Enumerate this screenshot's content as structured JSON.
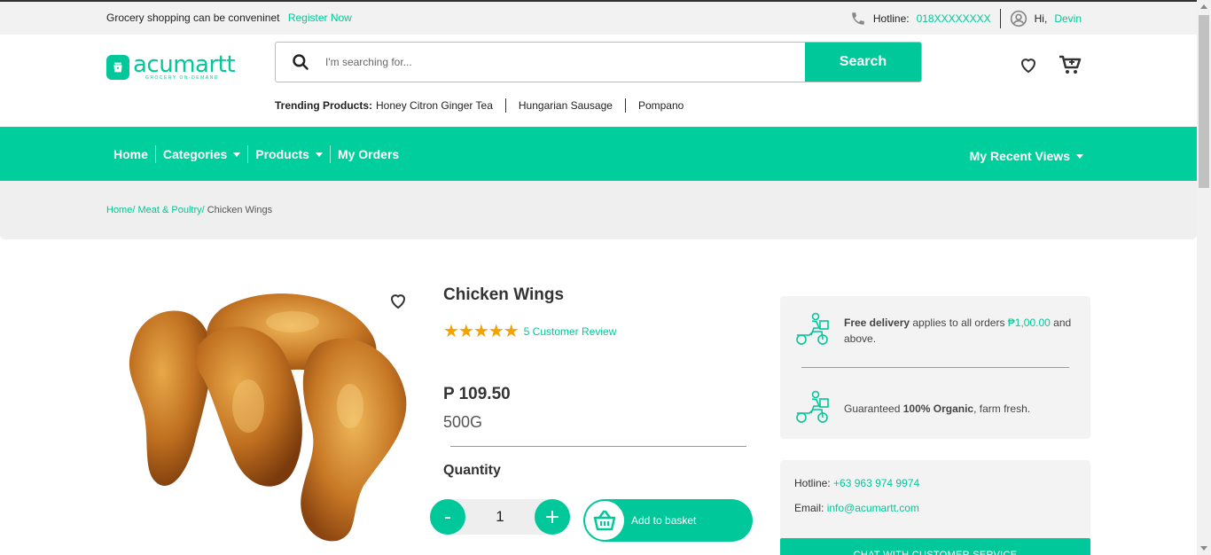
{
  "topbar": {
    "tagline": "Grocery shopping can be conveninet",
    "register": "Register Now",
    "hotline_label": "Hotline:",
    "hotline_value": "018XXXXXXXX",
    "greeting": "Hi,",
    "username": "Devin"
  },
  "logo": {
    "name": "acumartt",
    "tagline": "GROCERY ON-DEMAND"
  },
  "search": {
    "placeholder": "I'm searching for...",
    "button": "Search"
  },
  "trending": {
    "label": "Trending Products:",
    "items": [
      "Honey Citron Ginger Tea",
      "Hungarian Sausage",
      "Pompano"
    ]
  },
  "nav": {
    "items": [
      "Home",
      "Categories",
      "Products",
      "My Orders"
    ],
    "recent": "My Recent Views"
  },
  "breadcrumb": {
    "home": "Home/",
    "category": "Meat & Poultry/",
    "current": " Chicken Wings"
  },
  "product": {
    "title": "Chicken Wings",
    "stars": "★★★★★",
    "reviews": "5 Customer Review",
    "price": "P 109.50",
    "weight": "500G",
    "quantity_label": "Quantity",
    "quantity": "1",
    "minus": "-",
    "plus": "+",
    "add_to_basket": "Add to basket"
  },
  "info": {
    "delivery_bold": "Free delivery",
    "delivery_text": " applies to all orders ",
    "delivery_amount": "₱1,00.00",
    "delivery_tail": " and above.",
    "organic_pre": "Guaranteed ",
    "organic_bold": "100% Organic",
    "organic_tail": ", farm fresh.",
    "hotline_label": "Hotline: ",
    "hotline_value": "+63 963 974 9974",
    "email_label": "Email: ",
    "email_value": "info@acumartt.com",
    "chat": "CHAT WITH CUSTOMER SERVICE"
  },
  "colors": {
    "accent": "#00c89a",
    "star": "#f5a100"
  }
}
